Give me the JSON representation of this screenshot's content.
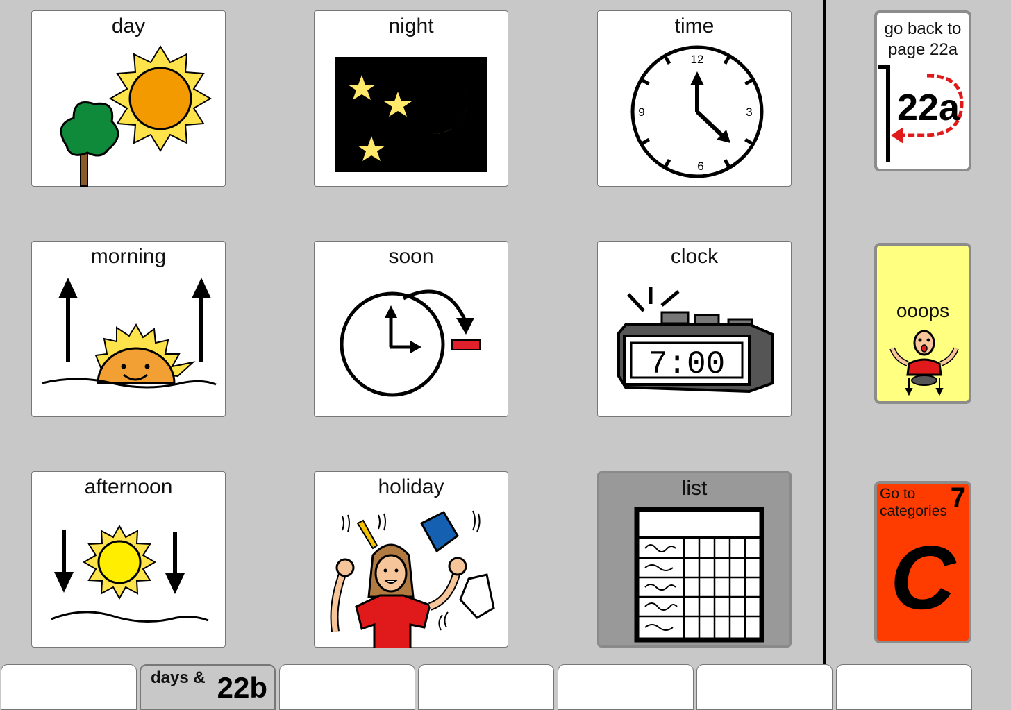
{
  "grid": {
    "cells": [
      {
        "label": "day"
      },
      {
        "label": "night"
      },
      {
        "label": "time"
      },
      {
        "label": "morning"
      },
      {
        "label": "soon"
      },
      {
        "label": "clock"
      },
      {
        "label": "afternoon"
      },
      {
        "label": "holiday"
      },
      {
        "label": "list"
      }
    ]
  },
  "time_cell": {
    "n12": "12",
    "n3": "3",
    "n6": "6",
    "n9": "9"
  },
  "clock_cell": {
    "display": "7:00"
  },
  "sidebar": {
    "back": {
      "label_line1": "go back to",
      "label_line2": "page 22a",
      "page": "22a"
    },
    "oops": {
      "label": "ooops"
    },
    "categories": {
      "label_line1": "Go to",
      "label_line2": "categories",
      "number": "7",
      "letter": "C"
    }
  },
  "tabs": [
    {
      "label": ""
    },
    {
      "label": "days &",
      "page": "22b"
    },
    {
      "label": ""
    },
    {
      "label": ""
    },
    {
      "label": ""
    },
    {
      "label": ""
    },
    {
      "label": ""
    }
  ],
  "colors": {
    "background": "#c8c8c8",
    "oops_bg": "#ffff80",
    "categories_bg": "#ff3c00",
    "list_bg": "#999999"
  }
}
